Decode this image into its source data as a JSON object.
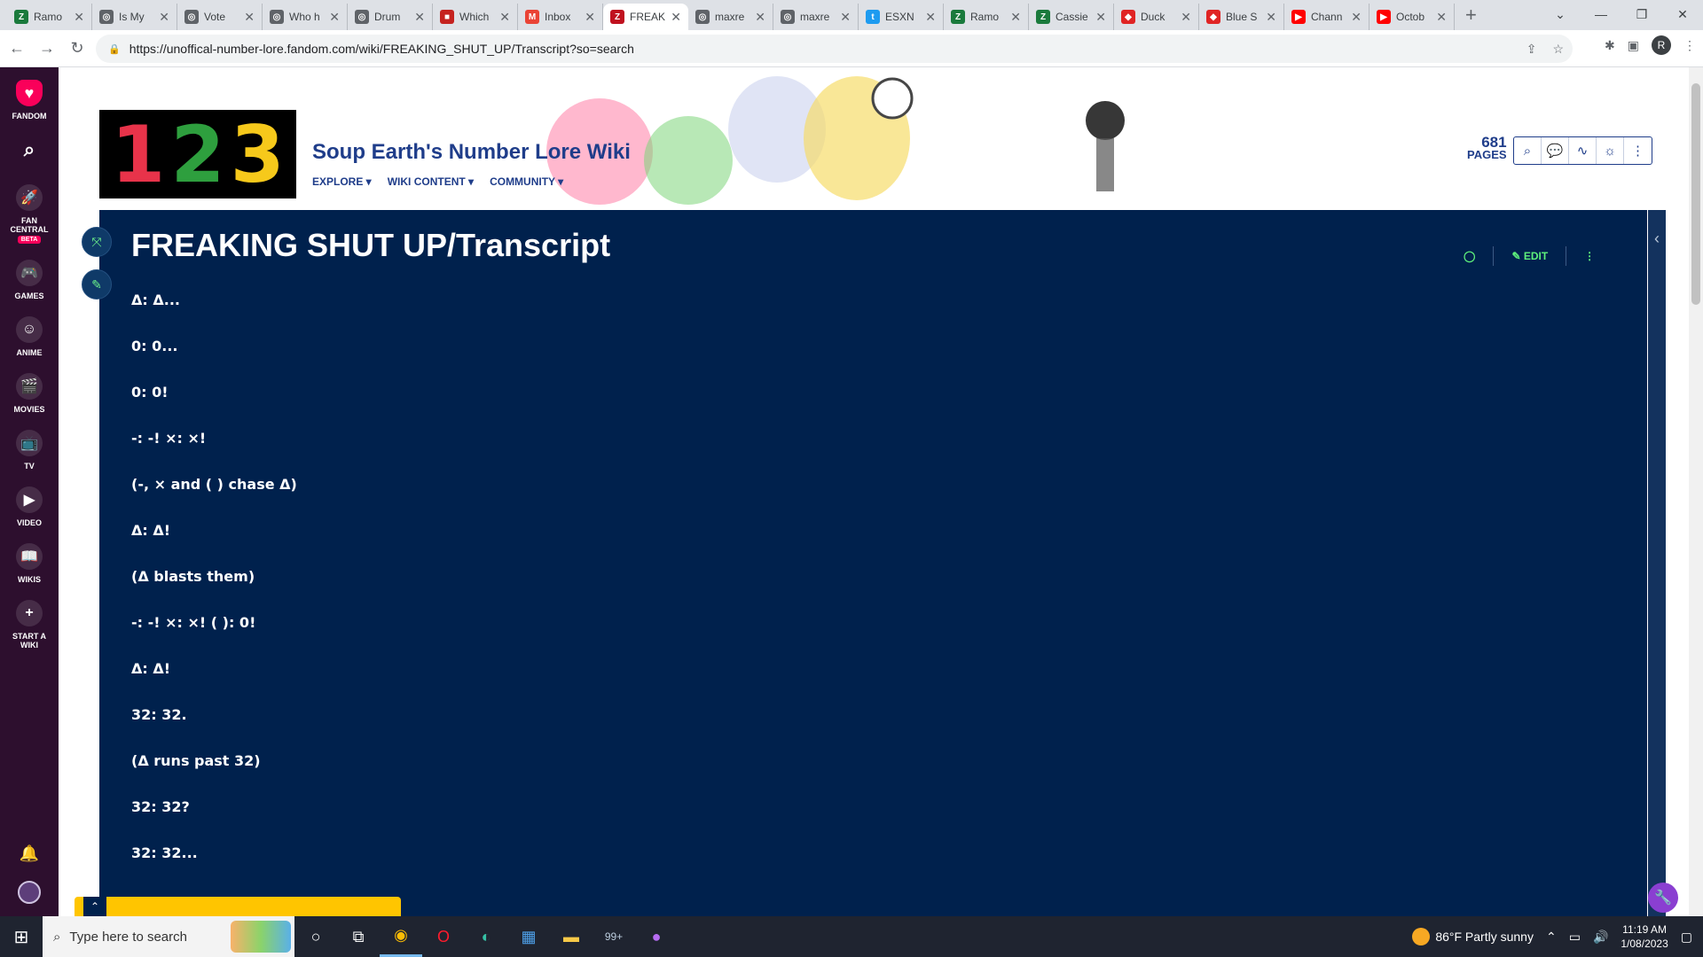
{
  "browser": {
    "tabs": [
      {
        "title": "Ramo",
        "color": "#1a7a3c",
        "glyph": "Z"
      },
      {
        "title": "Is My",
        "color": "#5f6368",
        "glyph": "◎"
      },
      {
        "title": "Vote",
        "color": "#5f6368",
        "glyph": "◎"
      },
      {
        "title": "Who h",
        "color": "#5f6368",
        "glyph": "◎"
      },
      {
        "title": "Drum",
        "color": "#5f6368",
        "glyph": "◎"
      },
      {
        "title": "Which",
        "color": "#c5221f",
        "glyph": "■"
      },
      {
        "title": "Inbox",
        "color": "#ea4335",
        "glyph": "M"
      },
      {
        "title": "FREAK",
        "color": "#c0111f",
        "glyph": "Z"
      },
      {
        "title": "maxre",
        "color": "#5f6368",
        "glyph": "◎"
      },
      {
        "title": "maxre",
        "color": "#5f6368",
        "glyph": "◎"
      },
      {
        "title": "ESXN",
        "color": "#1d9bf0",
        "glyph": "t"
      },
      {
        "title": "Ramo",
        "color": "#1a7a3c",
        "glyph": "Z"
      },
      {
        "title": "Cassie",
        "color": "#1a7a3c",
        "glyph": "Z"
      },
      {
        "title": "Duck",
        "color": "#e02424",
        "glyph": "◆"
      },
      {
        "title": "Blue S",
        "color": "#e02424",
        "glyph": "◆"
      },
      {
        "title": "Chann",
        "color": "#ff0000",
        "glyph": "▶"
      },
      {
        "title": "Octob",
        "color": "#ff0000",
        "glyph": "▶"
      }
    ],
    "active_tab": 7,
    "url": "https://unoffical-number-lore.fandom.com/wiki/FREAKING_SHUT_UP/Transcript?so=search",
    "profile_initial": "R"
  },
  "fandom_nav": {
    "logo_label": "FANDOM",
    "items": [
      {
        "label": "FAN CENTRAL",
        "icon": "rocket-icon",
        "glyph": "🚀",
        "badge": "BETA"
      },
      {
        "label": "GAMES",
        "icon": "gamepad-icon",
        "glyph": "🎮"
      },
      {
        "label": "ANIME",
        "icon": "anime-icon",
        "glyph": "☺"
      },
      {
        "label": "MOVIES",
        "icon": "clapper-icon",
        "glyph": "🎬"
      },
      {
        "label": "TV",
        "icon": "tv-icon",
        "glyph": "📺"
      },
      {
        "label": "VIDEO",
        "icon": "video-icon",
        "glyph": "▶"
      },
      {
        "label": "WIKIS",
        "icon": "book-icon",
        "glyph": "📖"
      },
      {
        "label": "START A WIKI",
        "icon": "plus-icon",
        "glyph": "+"
      }
    ]
  },
  "wiki": {
    "logo_digits": [
      "1",
      "2",
      "3"
    ],
    "title": "Soup Earth's Number Lore Wiki",
    "nav": [
      "EXPLORE ▾",
      "WIKI CONTENT ▾",
      "COMMUNITY ▾"
    ],
    "page_count": "681",
    "pages_label": "PAGES"
  },
  "article": {
    "title": "FREAKING SHUT UP/Transcript",
    "edit_label": "EDIT",
    "lines": [
      "Δ: Δ...",
      "0: 0...",
      "0: 0!",
      "-: -! ×: ×!",
      "(-, × and ( ) chase Δ)",
      "Δ: Δ!",
      "(Δ blasts them)",
      "-: -! ×: ×! ( ): 0!",
      "Δ: Δ!",
      "32: 32.",
      "(Δ runs past 32)",
      "32: 32?",
      "32: 32..."
    ]
  },
  "taskbar": {
    "search_placeholder": "Type here to search",
    "mail_badge": "99+",
    "weather": "86°F  Partly sunny",
    "time": "11:19 AM",
    "date": "1/08/2023"
  },
  "colors": {
    "fandom_bar": "#2d0f2e",
    "content_bg": "#00214d",
    "accent_green": "#5ef07c",
    "wiki_blue": "#1f3d8a"
  }
}
